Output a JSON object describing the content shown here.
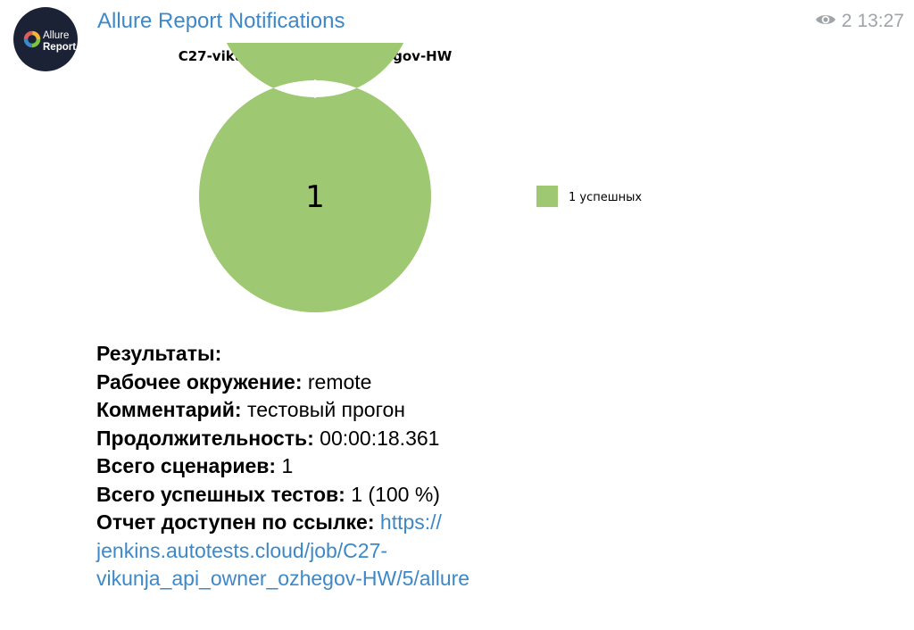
{
  "message": {
    "sender": "Allure Report Notifications",
    "views": "2",
    "time": "13:27",
    "avatar": {
      "line1": "Allure",
      "line2": "Report",
      "bg_color": "#1c2236",
      "ring_colors": [
        "#7dc243",
        "#3e88c7",
        "#e05b5b",
        "#f4b63a"
      ]
    }
  },
  "chart_data": {
    "type": "pie",
    "title": "C27-vikunja_api_owner_ozhegov-HW",
    "center_label": "1",
    "donut": true,
    "legend_position": "right",
    "slices": [
      {
        "label": "1 успешных",
        "value": 1,
        "color": "#9ec872"
      }
    ]
  },
  "results": {
    "heading": "Результаты:",
    "env_label": "Рабочее окружение:",
    "env_value": "remote",
    "comment_label": "Комментарий:",
    "comment_value": "тестовый прогон",
    "duration_label": "Продолжительность:",
    "duration_value": "00:00:18.361",
    "total_label": "Всего сценариев:",
    "total_value": "1",
    "passed_label": "Всего успешных тестов:",
    "passed_value": "1 (100 %)",
    "report_label": "Отчет доступен по ссылке:",
    "report_link": "https://jenkins.autotests.cloud/job/C27-vikunja_api_owner_ozhegov-HW/5/allure"
  }
}
